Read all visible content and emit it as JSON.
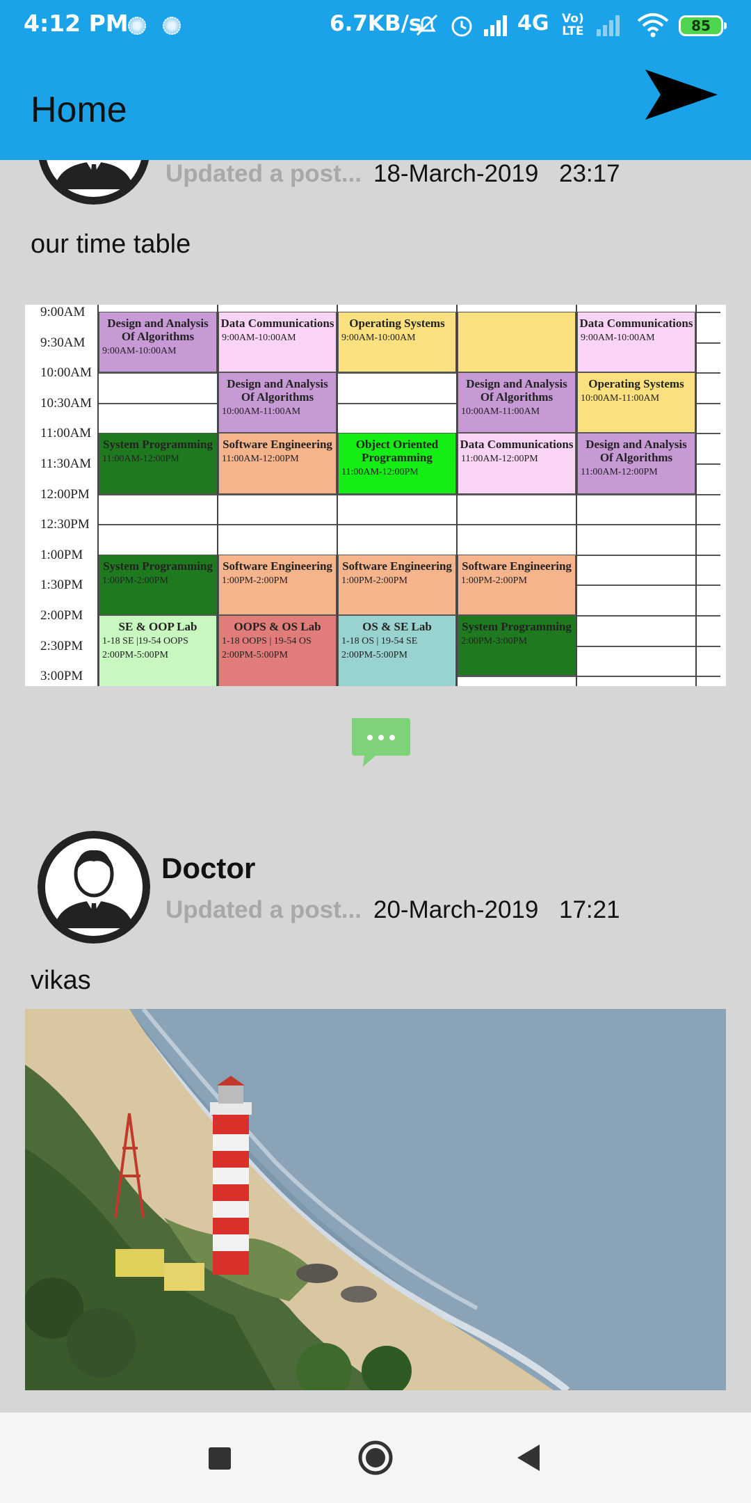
{
  "status_bar": {
    "time": "4:12 PM",
    "network_speed": "6.7KB/s",
    "network_type": "4G",
    "volte_label_line1": "Vo)",
    "volte_label_line2": "LTE",
    "battery_level": "85"
  },
  "app_bar": {
    "title": "Home",
    "send_icon": "send-icon"
  },
  "posts": [
    {
      "name": "",
      "action": "Updated a post...",
      "date": "18-March-2019",
      "time": "23:17",
      "text": "our time table",
      "image": {
        "type": "timetable",
        "times": [
          "9:00AM",
          "9:30AM",
          "10:00AM",
          "10:30AM",
          "11:00AM",
          "11:30AM",
          "12:00PM",
          "12:30PM",
          "1:00PM",
          "1:30PM",
          "2:00PM",
          "2:30PM",
          "3:00PM"
        ],
        "cells": [
          {
            "title": "Design and Analysis Of Algorithms",
            "time": "9:00AM-10:00AM",
            "color": "#c79ad6"
          },
          {
            "title": "Data Communications",
            "time": "9:00AM-10:00AM",
            "color": "#f9d4f4"
          },
          {
            "title": "Operating Systems",
            "time": "9:00AM-10:00AM",
            "color": "#fbe07f"
          },
          {
            "title": "",
            "time": "",
            "color": "#fbe07f"
          },
          {
            "title": "Data Communications",
            "time": "9:00AM-10:00AM",
            "color": "#f9d4f4"
          },
          {
            "title": "Design and Analysis Of Algorithms",
            "time": "10:00AM-11:00AM",
            "color": "#c79ad6"
          },
          {
            "title": "Design and Analysis Of Algorithms",
            "time": "10:00AM-11:00AM",
            "color": "#c79ad6"
          },
          {
            "title": "Operating Systems",
            "time": "10:00AM-11:00AM",
            "color": "#fbe07f"
          },
          {
            "title": "System Programming",
            "time": "11:00AM-12:00PM",
            "color": "#1f7a1f"
          },
          {
            "title": "Software Engineering",
            "time": "11:00AM-12:00PM",
            "color": "#f5b48c"
          },
          {
            "title": "Object Oriented Programming",
            "time": "11:00AM-12:00PM",
            "color": "#14ee14"
          },
          {
            "title": "Data Communications",
            "time": "11:00AM-12:00PM",
            "color": "#f9d4f4"
          },
          {
            "title": "Design and Analysis Of Algorithms",
            "time": "11:00AM-12:00PM",
            "color": "#c79ad6"
          },
          {
            "title": "System Programming",
            "time": "1:00PM-2:00PM",
            "color": "#1f7a1f"
          },
          {
            "title": "Software Engineering",
            "time": "1:00PM-2:00PM",
            "color": "#f5b48c"
          },
          {
            "title": "Software Engineering",
            "time": "1:00PM-2:00PM",
            "color": "#f5b48c"
          },
          {
            "title": "Software Engineering",
            "time": "1:00PM-2:00PM",
            "color": "#f5b48c"
          },
          {
            "title": "SE & OOP Lab",
            "time": "1-18 SE |19-54 OOPS",
            "time2": "2:00PM-5:00PM",
            "color": "#c8f7c0"
          },
          {
            "title": "OOPS & OS Lab",
            "time": "1-18 OOPS | 19-54 OS",
            "time2": "2:00PM-5:00PM",
            "color": "#e07d7b"
          },
          {
            "title": "OS & SE Lab",
            "time": "1-18 OS | 19-54 SE",
            "time2": "2:00PM-5:00PM",
            "color": "#98d3cf"
          },
          {
            "title": "System Programming",
            "time": "2:00PM-3:00PM",
            "color": "#1f7a1f"
          }
        ]
      }
    },
    {
      "name": "Doctor",
      "action": "Updated a post...",
      "date": "20-March-2019",
      "time": "17:21",
      "text": "vikas",
      "image": {
        "type": "photo",
        "subject": "lighthouse-beach"
      }
    }
  ],
  "comment_icon": "chat-bubble-icon",
  "nav": {
    "recents_icon": "square-recents-icon",
    "home_icon": "circle-home-icon",
    "back_icon": "triangle-back-icon"
  },
  "colors": {
    "app_bar": "#1aa3e8",
    "background": "#d6d6d6",
    "comment_button": "#7ed37a",
    "muted_text": "#a8a8a8"
  }
}
